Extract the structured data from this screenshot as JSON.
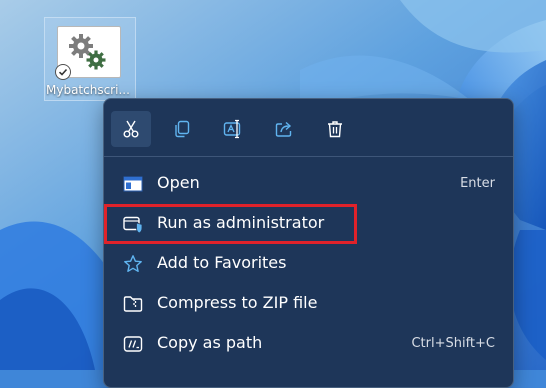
{
  "desktop": {
    "file_name": "Mybatchscri...",
    "file_icon": "gear-file-icon",
    "badge_icon": "sync-check-icon"
  },
  "context_menu": {
    "toolbar": [
      {
        "name": "cut",
        "icon": "scissors-icon"
      },
      {
        "name": "copy",
        "icon": "copy-icon"
      },
      {
        "name": "rename",
        "icon": "rename-icon"
      },
      {
        "name": "share",
        "icon": "share-icon"
      },
      {
        "name": "delete",
        "icon": "trash-icon"
      }
    ],
    "items": [
      {
        "label": "Open",
        "shortcut": "Enter",
        "icon": "window-icon"
      },
      {
        "label": "Run as administrator",
        "shortcut": "",
        "icon": "shield-icon"
      },
      {
        "label": "Add to Favorites",
        "shortcut": "",
        "icon": "star-icon"
      },
      {
        "label": "Compress to ZIP file",
        "shortcut": "",
        "icon": "zip-folder-icon"
      },
      {
        "label": "Copy as path",
        "shortcut": "Ctrl+Shift+C",
        "icon": "path-icon"
      }
    ],
    "highlighted_item": "Run as administrator",
    "highlight_color": "#e0222a",
    "accent_color": "#60b4f0",
    "menu_background": "#1e3659"
  }
}
